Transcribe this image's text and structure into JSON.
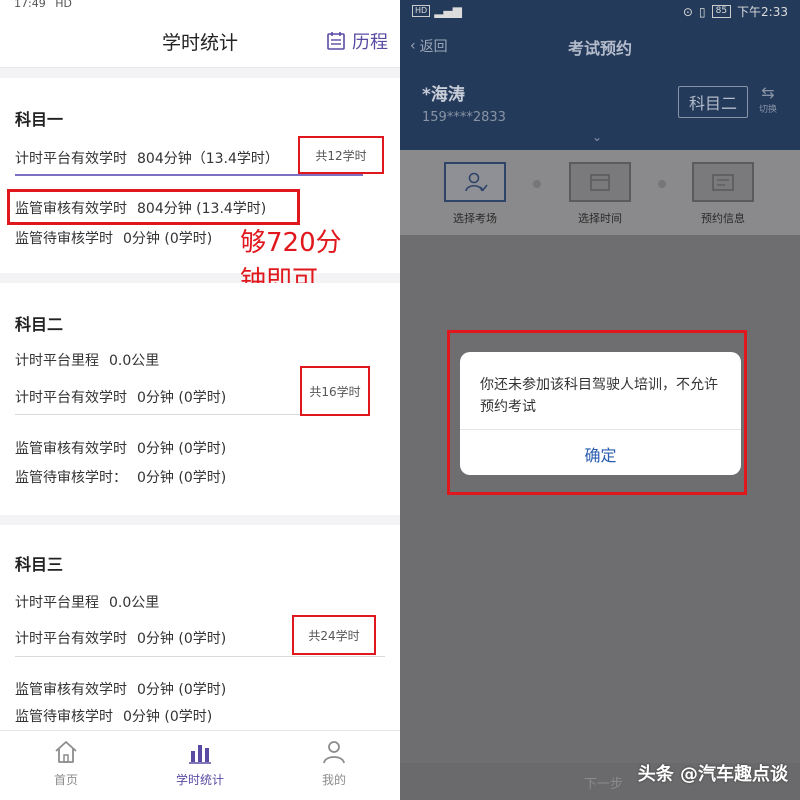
{
  "left": {
    "status_time": "17:49",
    "status_net": "HD",
    "nav": {
      "title": "学时统计",
      "history_label": "历程"
    },
    "subject1": {
      "title": "科目一",
      "row1_label": "计时平台有效学时",
      "row1_value": "804分钟（13.4学时）",
      "badge": "共12学时",
      "row2_label": "监管审核有效学时",
      "row2_value": "804分钟 (13.4学时)",
      "row3_label": "监管待审核学时",
      "row3_value": "0分钟  (0学时)",
      "annotation_line1": "够720分",
      "annotation_line2": "钟即可"
    },
    "subject2": {
      "title": "科目二",
      "mileage_label": "计时平台里程",
      "mileage_value": "0.0公里",
      "row1_label": "计时平台有效学时",
      "row1_value": "0分钟  (0学时)",
      "badge": "共16学时",
      "row2_label": "监管审核有效学时",
      "row2_value": "0分钟  (0学时)",
      "row3_label": "监管待审核学时：",
      "row3_value": "0分钟  (0学时)"
    },
    "subject3": {
      "title": "科目三",
      "mileage_label": "计时平台里程",
      "mileage_value": "0.0公里",
      "row1_label": "计时平台有效学时",
      "row1_value": "0分钟  (0学时)",
      "badge": "共24学时",
      "row2_label": "监管审核有效学时",
      "row2_value": "0分钟  (0学时)",
      "row3_label": "监管待审核学时",
      "row3_value": "0分钟  (0学时)"
    },
    "tabs": [
      {
        "label": "首页",
        "icon": "home-icon"
      },
      {
        "label": "学时统计",
        "icon": "bar-chart-icon"
      },
      {
        "label": "我的",
        "icon": "user-icon"
      }
    ],
    "colors": {
      "accent": "#5a4aa3",
      "highlight": "#e0171c"
    }
  },
  "right": {
    "status_time": "下午2:33",
    "status_battery": "85",
    "status_net": "HD",
    "back_label": "返回",
    "title": "考试预约",
    "user_name": "*海涛",
    "user_phone": "159****2833",
    "subject_button": "科目二",
    "switch_label": "切换",
    "steps": [
      {
        "label": "选择考场"
      },
      {
        "label": "选择时间"
      },
      {
        "label": "预约信息"
      }
    ],
    "dialog": {
      "message": "你还未参加该科目驾驶人培训，不允许预约考试",
      "confirm": "确定"
    },
    "bottom_button": "下一步",
    "watermark": "头条 @汽车趣点谈",
    "colors": {
      "header": "#243a5a",
      "confirm": "#2a5db0"
    }
  }
}
